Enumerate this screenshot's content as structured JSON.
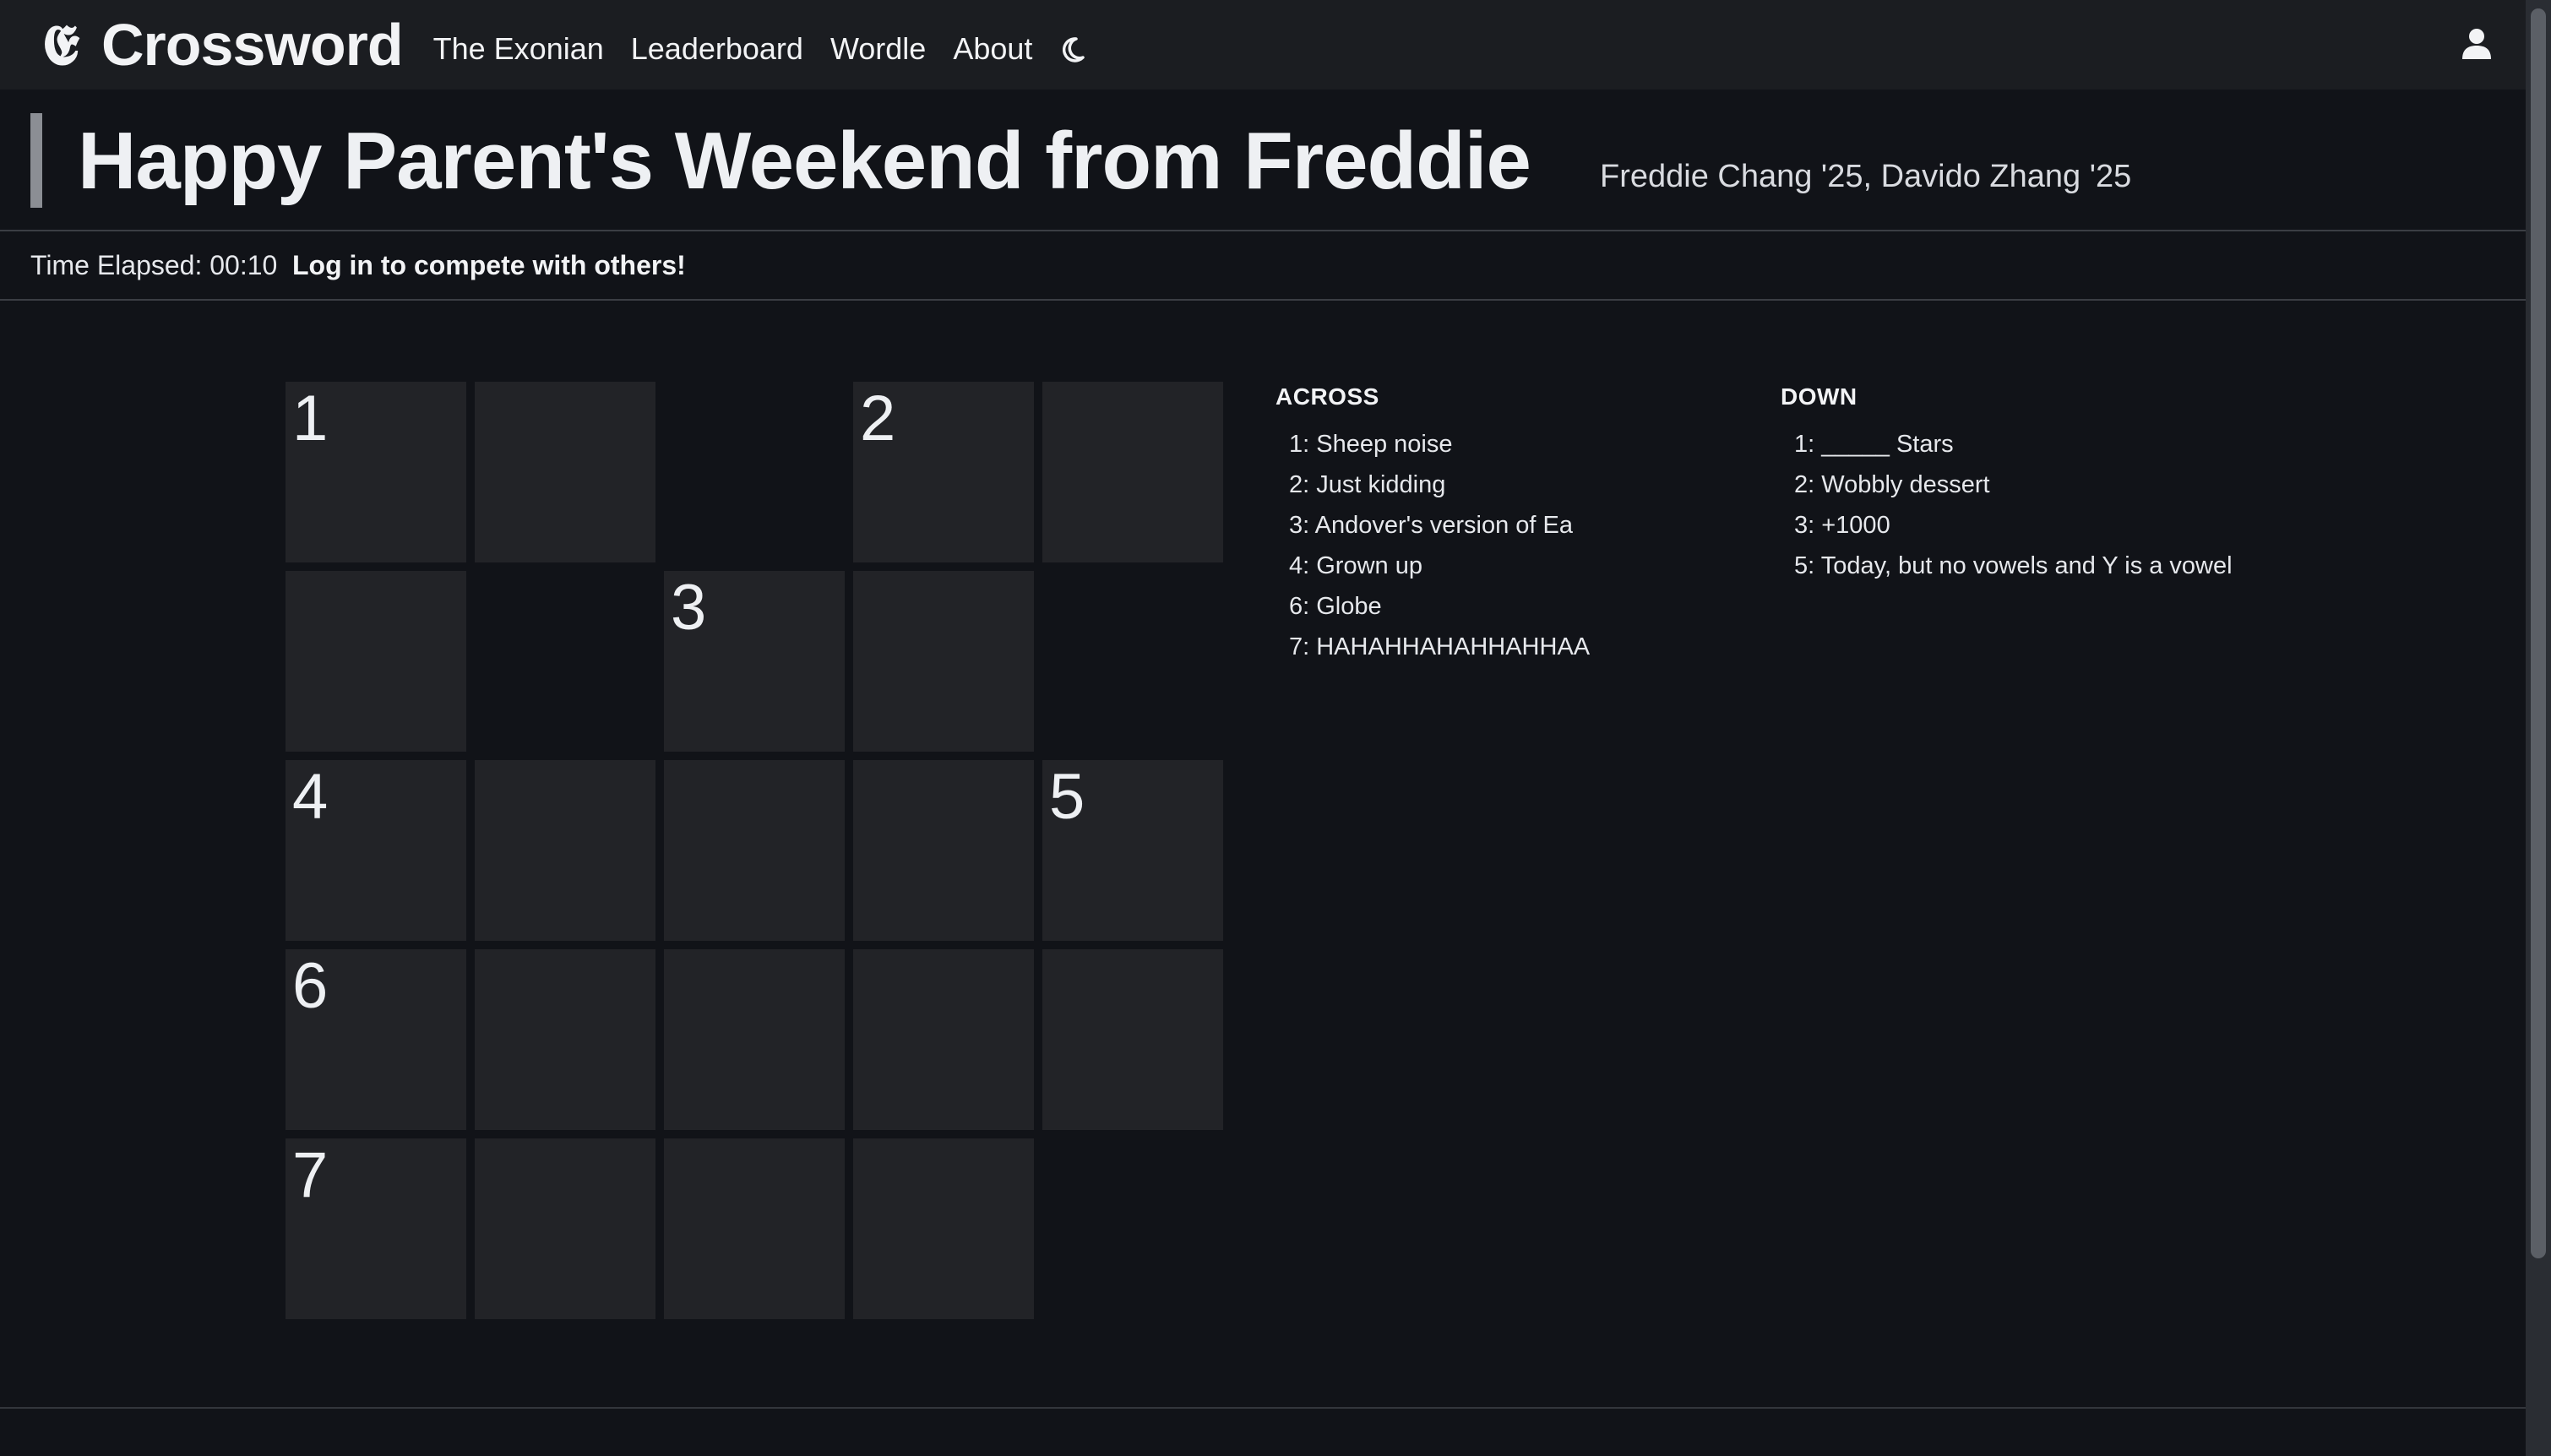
{
  "nav": {
    "brand_logo": "𝕰",
    "brand_name": "Crossword",
    "links": [
      "The Exonian",
      "Leaderboard",
      "Wordle",
      "About"
    ],
    "moon_icon": "moon-icon",
    "user_icon": "user-icon"
  },
  "puzzle": {
    "title": "Happy Parent's Weekend from Freddie",
    "authors": "Freddie Chang '25, Davido Zhang '25"
  },
  "status": {
    "timer": "Time Elapsed: 00:10",
    "login_prompt": "Log in to compete with others!"
  },
  "grid": {
    "rows": 5,
    "cols": 5,
    "cells": [
      [
        "1",
        "",
        "#",
        "2",
        ""
      ],
      [
        "",
        "#",
        "3",
        "",
        "#"
      ],
      [
        "4",
        "",
        "",
        "",
        "5"
      ],
      [
        "6",
        "",
        "",
        "",
        ""
      ],
      [
        "7",
        "",
        "",
        "",
        "#"
      ]
    ]
  },
  "clues": {
    "across_heading": "ACROSS",
    "across": [
      "1: Sheep noise",
      "2: Just kidding",
      "3: Andover's version of Ea",
      "4: Grown up",
      "6: Globe",
      "7: HAHAHHAHAHHAHHAA"
    ],
    "down_heading": "DOWN",
    "down": [
      "1: _____ Stars",
      "2: Wobbly dessert",
      "3: +1000",
      "5: Today, but no vowels and Y is a vowel"
    ]
  },
  "colors": {
    "background": "#111318",
    "navbar": "#1b1d21",
    "cell": "#222327",
    "text": "#e6e8ec"
  }
}
